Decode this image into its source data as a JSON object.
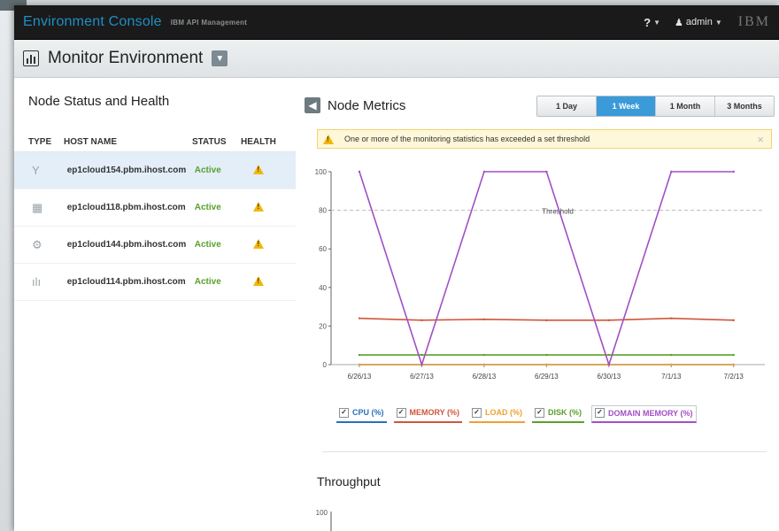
{
  "app": {
    "title": "Environment Console",
    "subtitle": "IBM API Management",
    "help_label": "?",
    "user_label": "admin",
    "brand": "IBM"
  },
  "header": {
    "title": "Monitor Environment"
  },
  "left_panel": {
    "title": "Node Status and Health",
    "columns": [
      "TYPE",
      "HOST NAME",
      "STATUS",
      "HEALTH"
    ],
    "rows": [
      {
        "type_icon": "router-icon",
        "glyph": "Y",
        "host": "ep1cloud154.pbm.ihost.com",
        "status": "Active",
        "health": "warning"
      },
      {
        "type_icon": "grid-icon",
        "glyph": "▦",
        "host": "ep1cloud118.pbm.ihost.com",
        "status": "Active",
        "health": "warning"
      },
      {
        "type_icon": "gear-icon",
        "glyph": "⚙",
        "host": "ep1cloud144.pbm.ihost.com",
        "status": "Active",
        "health": "warning"
      },
      {
        "type_icon": "bars-icon",
        "glyph": "ılı",
        "host": "ep1cloud114.pbm.ihost.com",
        "status": "Active",
        "health": "warning"
      }
    ]
  },
  "metrics": {
    "title": "Node Metrics",
    "ranges": [
      "1 Day",
      "1 Week",
      "1 Month",
      "3 Months"
    ],
    "active_range": "1 Week",
    "alert_text": "One or more of the monitoring statistics has exceeded a set threshold",
    "alert_close": "×",
    "throughput_title": "Throughput",
    "throughput_ytick": "100"
  },
  "chart_data": {
    "type": "line",
    "x": [
      "6/26/13",
      "6/27/13",
      "6/28/13",
      "6/29/13",
      "6/30/13",
      "7/1/13",
      "7/2/13"
    ],
    "ylim": [
      0,
      100
    ],
    "yticks": [
      "0",
      "20",
      "40",
      "60",
      "80",
      "100"
    ],
    "threshold": {
      "value": 80,
      "label": "Threshold"
    },
    "series": [
      {
        "name": "CPU (%)",
        "color": "#2a6fbf",
        "values": [
          0,
          0,
          0,
          0,
          0,
          0,
          0
        ]
      },
      {
        "name": "MEMORY (%)",
        "color": "#d0553b",
        "values": [
          24,
          23,
          23.5,
          23,
          23,
          24,
          23
        ]
      },
      {
        "name": "LOAD (%)",
        "color": "#f0a030",
        "values": [
          0,
          0,
          0,
          0,
          0,
          0,
          0
        ]
      },
      {
        "name": "DISK (%)",
        "color": "#5aa02c",
        "values": [
          5,
          5,
          5,
          5,
          5,
          5,
          5
        ]
      },
      {
        "name": "DOMAIN MEMORY (%)",
        "color": "#a24fc4",
        "values": [
          100,
          0,
          100,
          100,
          0,
          100,
          100
        ]
      }
    ]
  }
}
